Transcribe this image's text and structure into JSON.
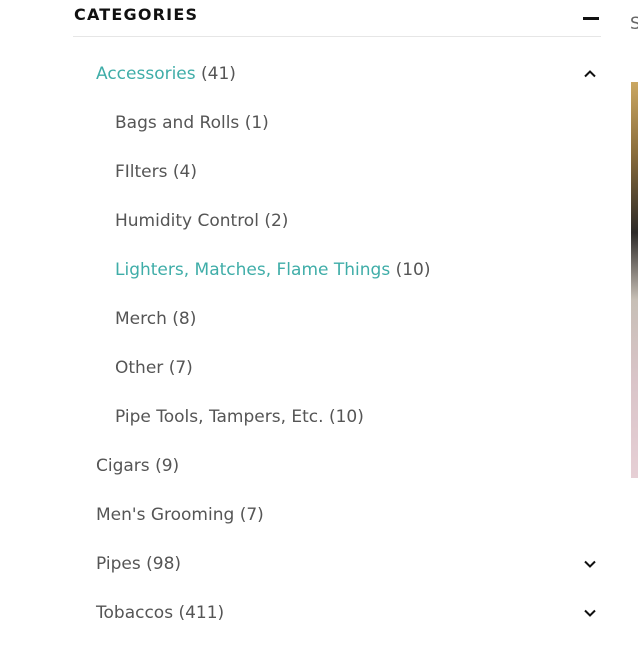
{
  "categories": {
    "title": "CATEGORIES",
    "items": [
      {
        "label": "Accessories",
        "count": "(41)",
        "active": true,
        "level": 0,
        "expander": "chevron-up"
      },
      {
        "label": "Bags and Rolls",
        "count": "(1)",
        "level": 1
      },
      {
        "label": "FIlters",
        "count": "(4)",
        "level": 1
      },
      {
        "label": "Humidity Control",
        "count": "(2)",
        "level": 1
      },
      {
        "label": "Lighters, Matches, Flame Things",
        "count": "(10)",
        "active": true,
        "level": 1
      },
      {
        "label": "Merch",
        "count": "(8)",
        "level": 1
      },
      {
        "label": "Other",
        "count": "(7)",
        "level": 1
      },
      {
        "label": "Pipe Tools, Tampers, Etc.",
        "count": "(10)",
        "level": 1
      },
      {
        "label": "Cigars",
        "count": "(9)",
        "level": 0
      },
      {
        "label": "Men's Grooming",
        "count": "(7)",
        "level": 0
      },
      {
        "label": "Pipes",
        "count": "(98)",
        "level": 0,
        "expander": "chevron-down"
      },
      {
        "label": "Tobaccos",
        "count": "(411)",
        "level": 0,
        "expander": "chevron-down"
      }
    ]
  },
  "side": {
    "text": "S"
  },
  "colors": {
    "accent": "#3fada8",
    "text": "#555555",
    "heading": "#111111"
  }
}
